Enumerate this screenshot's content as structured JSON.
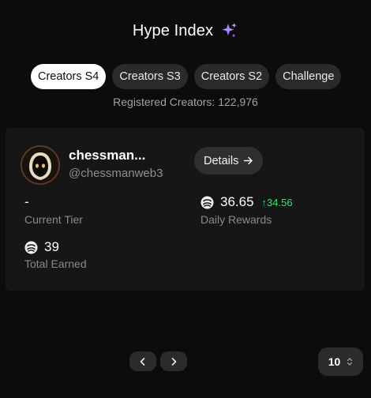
{
  "header": {
    "title": "Hype Index",
    "title_icon": "sparkles-icon",
    "accent_color": "#9b7bff"
  },
  "tabs": [
    {
      "label": "Creators S4",
      "active": true
    },
    {
      "label": "Creators S3",
      "active": false
    },
    {
      "label": "Creators S2",
      "active": false
    },
    {
      "label": "Challenge",
      "active": false
    }
  ],
  "registered": {
    "text": "Registered Creators: 122,976"
  },
  "creator": {
    "name": "chessman...",
    "handle": "@chessmanweb3",
    "details_label": "Details",
    "details_icon": "arrow-right-icon",
    "tier_value": "-",
    "tier_label": "Current Tier",
    "daily_rewards_value": "36.65",
    "daily_rewards_delta": "↑34.56",
    "daily_rewards_label": "Daily Rewards",
    "total_earned_value": "39",
    "total_earned_label": "Total Earned",
    "coin_icon": "coin-icon",
    "delta_color": "#3ddc73"
  },
  "pagination": {
    "prev_icon": "chevron-left-icon",
    "next_icon": "chevron-right-icon",
    "per_page": "10",
    "per_page_icon": "chevron-up-down-icon"
  }
}
